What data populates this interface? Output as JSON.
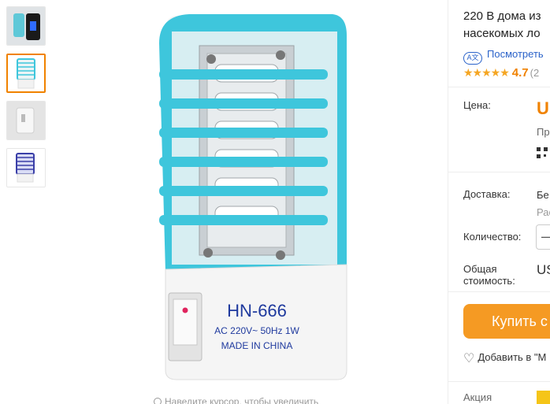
{
  "thumbnails": [
    {
      "name": "thumb-1",
      "active": false
    },
    {
      "name": "thumb-2",
      "active": true
    },
    {
      "name": "thumb-3",
      "active": false
    },
    {
      "name": "thumb-4",
      "active": false
    }
  ],
  "main_image": {
    "model": "HN-666",
    "spec": "AC 220V~ 50Hz 1W",
    "origin": "MADE IN CHINA",
    "zoom_hint": "Наведите курсор, чтобы увеличить"
  },
  "product": {
    "title_line1": "220 В дома из",
    "title_line2": "насекомых ло",
    "translate_icon": "A文",
    "translate_link": "Посмотреть",
    "stars": "★★★★★",
    "rating": "4.7",
    "rating_count": "(2"
  },
  "details": {
    "price_label": "Цена:",
    "price_value": "U",
    "price_sub": "Пр",
    "shipping_label": "Доставка:",
    "shipping_value": "Бе",
    "shipping_sub": "Рас",
    "quantity_label": "Количество:",
    "quantity_minus": "—",
    "total_label_1": "Общая",
    "total_label_2": "стоимость:",
    "total_value": "US",
    "buy_label": "Купить с",
    "wishlist": "Добавить в \"М",
    "promo_label": "Акция"
  },
  "colors": {
    "accent": "#f08200",
    "buy_button": "#f59a23",
    "link": "#2a62c9",
    "device_blue": "#3ec6dc"
  }
}
